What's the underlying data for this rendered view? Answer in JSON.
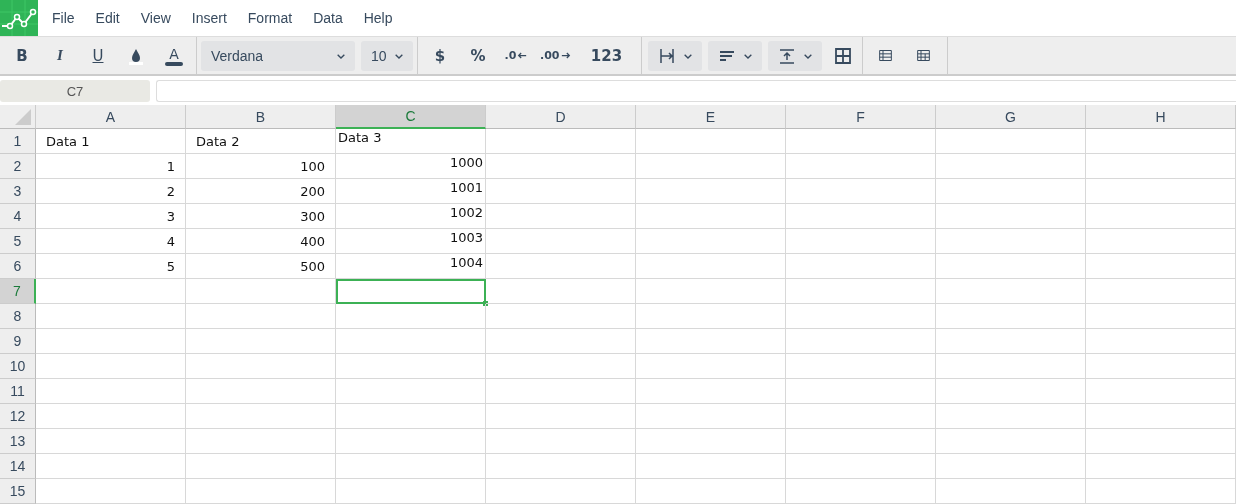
{
  "menu": [
    "File",
    "Edit",
    "View",
    "Insert",
    "Format",
    "Data",
    "Help"
  ],
  "toolbar": {
    "bold": "B",
    "italic": "I",
    "underline": "U",
    "text_color": "A",
    "font": "Verdana",
    "size": "10",
    "currency": "$",
    "percent": "%",
    "decrease_decimals": ".0",
    "increase_decimals": ".00",
    "number_format": "123"
  },
  "name_box": "C7",
  "columns": [
    {
      "label": "A",
      "selected": false,
      "top_aligned": false
    },
    {
      "label": "B",
      "selected": false,
      "top_aligned": false
    },
    {
      "label": "C",
      "selected": true,
      "top_aligned": true
    },
    {
      "label": "D",
      "selected": false,
      "top_aligned": false
    },
    {
      "label": "E",
      "selected": false,
      "top_aligned": false
    },
    {
      "label": "F",
      "selected": false,
      "top_aligned": false
    },
    {
      "label": "G",
      "selected": false,
      "top_aligned": false
    },
    {
      "label": "H",
      "selected": false,
      "top_aligned": false
    }
  ],
  "rows": [
    {
      "label": "1",
      "selected": false,
      "cells": [
        {
          "text": "Data 1",
          "kind": "text"
        },
        {
          "text": "Data 2",
          "kind": "text"
        },
        {
          "text": "Data 3",
          "kind": "text"
        }
      ]
    },
    {
      "label": "2",
      "selected": false,
      "cells": [
        {
          "text": "1",
          "kind": "number"
        },
        {
          "text": "100",
          "kind": "number"
        },
        {
          "text": "1000",
          "kind": "number"
        }
      ]
    },
    {
      "label": "3",
      "selected": false,
      "cells": [
        {
          "text": "2",
          "kind": "number"
        },
        {
          "text": "200",
          "kind": "number"
        },
        {
          "text": "1001",
          "kind": "number"
        }
      ]
    },
    {
      "label": "4",
      "selected": false,
      "cells": [
        {
          "text": "3",
          "kind": "number"
        },
        {
          "text": "300",
          "kind": "number"
        },
        {
          "text": "1002",
          "kind": "number"
        }
      ]
    },
    {
      "label": "5",
      "selected": false,
      "cells": [
        {
          "text": "4",
          "kind": "number"
        },
        {
          "text": "400",
          "kind": "number"
        },
        {
          "text": "1003",
          "kind": "number"
        }
      ]
    },
    {
      "label": "6",
      "selected": false,
      "cells": [
        {
          "text": "5",
          "kind": "number"
        },
        {
          "text": "500",
          "kind": "number"
        },
        {
          "text": "1004",
          "kind": "number"
        }
      ]
    },
    {
      "label": "7",
      "selected": true
    },
    {
      "label": "8",
      "selected": false
    },
    {
      "label": "9",
      "selected": false
    },
    {
      "label": "10",
      "selected": false
    },
    {
      "label": "11",
      "selected": false
    },
    {
      "label": "12",
      "selected": false
    },
    {
      "label": "13",
      "selected": false
    },
    {
      "label": "14",
      "selected": false
    },
    {
      "label": "15",
      "selected": false
    }
  ]
}
